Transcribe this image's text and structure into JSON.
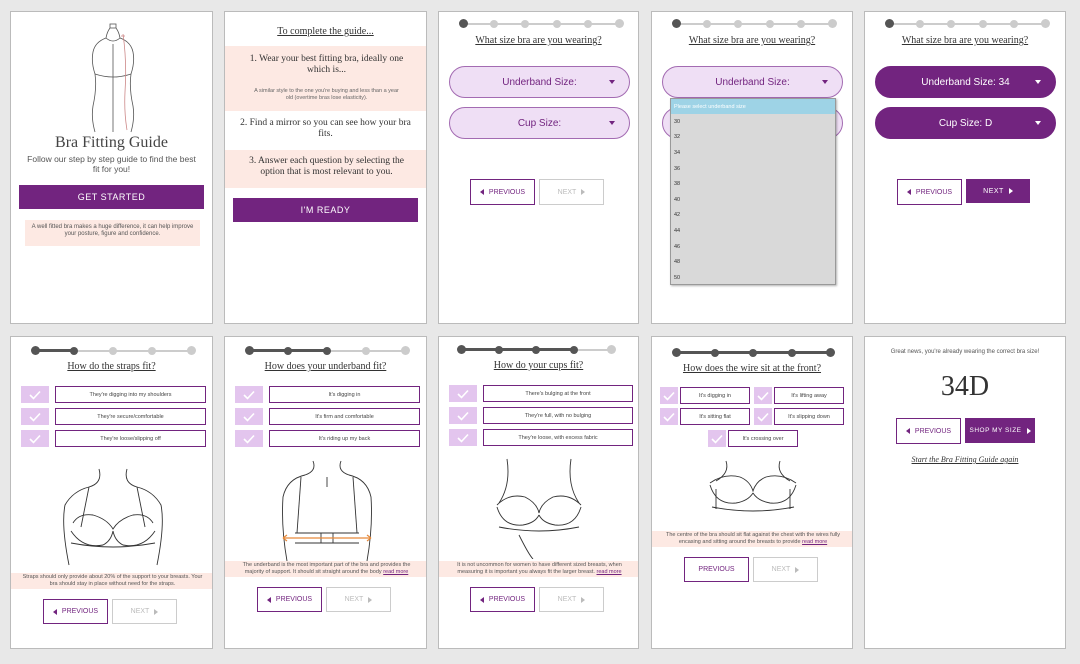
{
  "p1": {
    "title": "Bra Fitting Guide",
    "subtitle": "Follow our step by step guide to find the best fit for you!",
    "cta": "GET STARTED",
    "note": "A well fitted bra makes a huge difference, it can help improve your posture, figure and confidence."
  },
  "p2": {
    "heading": "To complete the guide...",
    "step1": "1. Wear your best fitting bra, ideally one which is...",
    "step1_note": "A similar style to the one you're buying and less than a year old (overtime bras lose elasticity).",
    "step2": "2. Find a mirror so you can see how your bra fits.",
    "step3": "3. Answer each question by selecting the option that is most relevant to you.",
    "cta": "I'M READY"
  },
  "p3": {
    "question": "What size bra are you wearing?",
    "underband": "Underband Size:",
    "cup": "Cup Size:",
    "prev": "PREVIOUS",
    "next": "NEXT"
  },
  "p4": {
    "question": "What size bra are you wearing?",
    "underband": "Underband Size:",
    "dropdown_header": "Please select underband size",
    "dropdown_options": [
      "30",
      "32",
      "34",
      "36",
      "38",
      "40",
      "42",
      "44",
      "46",
      "48",
      "50"
    ]
  },
  "p5": {
    "question": "What size bra are you wearing?",
    "underband": "Underband Size: 34",
    "cup": "Cup Size: D",
    "prev": "PREVIOUS",
    "next": "NEXT"
  },
  "p6": {
    "question": "How do the straps fit?",
    "options": [
      "They're digging into my shoulders",
      "They're secure/comfortable",
      "They're loose/slipping off"
    ],
    "note": "Straps should only provide about 20% of the support to your breasts. Your bra should stay in place without need for the straps.",
    "prev": "PREVIOUS",
    "next": "NEXT"
  },
  "p7": {
    "question": "How does your underband fit?",
    "options": [
      "It's digging in",
      "It's firm and comfortable",
      "It's riding up my back"
    ],
    "note": "The underband is the most important part of the bra and provides the majority of support. It should sit straight around the body",
    "read_more": "read more",
    "prev": "PREVIOUS",
    "next": "NEXT"
  },
  "p8": {
    "question": "How do your cups fit?",
    "options": [
      "There's bulging at the front",
      "They're full, with no bulging",
      "They're loose, with excess fabric"
    ],
    "note": "It is not uncommon for women to have different sized breasts, when measuring it is important you always fit the larger breast.",
    "read_more": "read more",
    "prev": "PREVIOUS",
    "next": "NEXT"
  },
  "p9": {
    "question": "How does the wire sit at the front?",
    "options": [
      "It's digging in",
      "It's lifting away",
      "It's sitting flat",
      "It's slipping down",
      "It's crossing over"
    ],
    "note": "The centre of the bra should sit flat against the chest with the wires fully encasing and sitting around the breasts to provide",
    "read_more": "read more",
    "prev": "PREVIOUS",
    "next": "NEXT"
  },
  "p10": {
    "message": "Great news, you're already wearing the correct bra size!",
    "size": "34D",
    "prev": "PREVIOUS",
    "shop": "SHOP MY SIZE",
    "restart": "Start the Bra Fitting Guide again"
  },
  "colors": {
    "accent": "#72247f",
    "accent_light": "#efdff5",
    "check_bg": "#e3c5ee",
    "note_bg": "#fde9e3",
    "dropdown_highlight": "#9ed3e6"
  }
}
